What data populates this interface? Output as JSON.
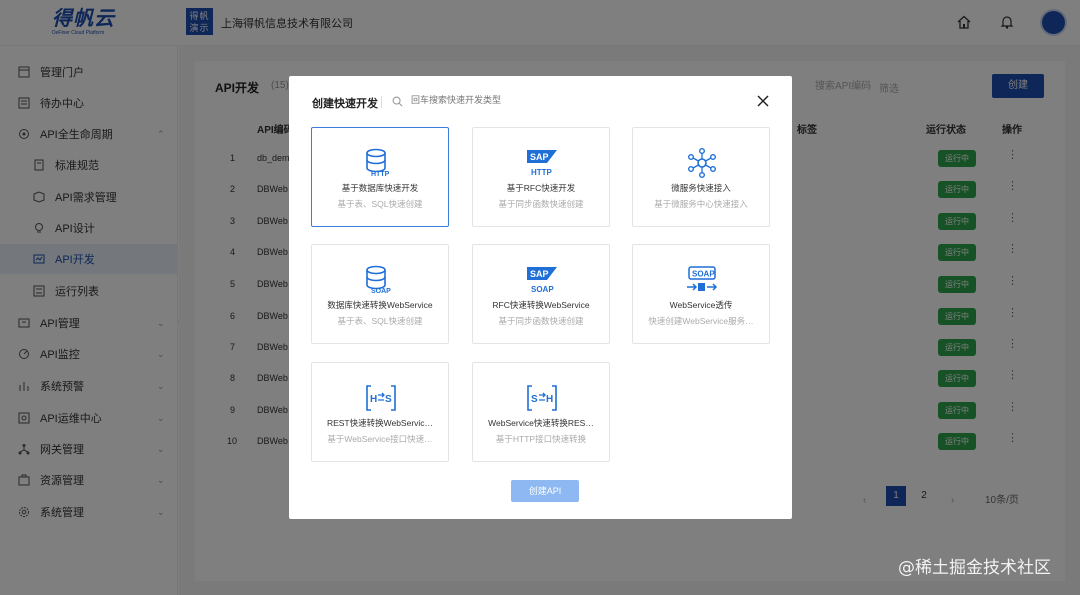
{
  "header": {
    "logo_text": "得帆云",
    "logo_sub": "DeFiner Cloud Platform",
    "company_badge": "得帆 演示",
    "company_name": "上海得帆信息技术有限公司",
    "icons": [
      "home-icon",
      "bell-icon"
    ],
    "avatar": "user-avatar"
  },
  "sidebar": {
    "items": [
      {
        "label": "管理门户",
        "icon": "portal-icon",
        "level": 0
      },
      {
        "label": "待办中心",
        "icon": "todo-icon",
        "level": 0
      },
      {
        "label": "API全生命周期",
        "icon": "lifecycle-icon",
        "level": 0,
        "expanded": true
      },
      {
        "label": "标准规范",
        "icon": "standard-icon",
        "level": 1
      },
      {
        "label": "API需求管理",
        "icon": "requirement-icon",
        "level": 1
      },
      {
        "label": "API设计",
        "icon": "design-icon",
        "level": 1
      },
      {
        "label": "API开发",
        "icon": "develop-icon",
        "level": 1,
        "active": true
      },
      {
        "label": "运行列表",
        "icon": "run-list-icon",
        "level": 1
      },
      {
        "label": "API管理",
        "icon": "api-manage-icon",
        "level": 0
      },
      {
        "label": "API监控",
        "icon": "monitor-icon",
        "level": 0
      },
      {
        "label": "系统预警",
        "icon": "alert-icon",
        "level": 0
      },
      {
        "label": "API运维中心",
        "icon": "ops-icon",
        "level": 0
      },
      {
        "label": "网关管理",
        "icon": "gateway-icon",
        "level": 0
      },
      {
        "label": "资源管理",
        "icon": "resource-icon",
        "level": 0
      },
      {
        "label": "系统管理",
        "icon": "settings-icon",
        "level": 0
      }
    ]
  },
  "main": {
    "title": "API开发",
    "count": "(15)",
    "search_placeholder": "搜索API编码",
    "filter_label": "筛选",
    "create_label": "创建",
    "columns": [
      "API编码",
      "标签",
      "运行状态",
      "操作"
    ],
    "rows": [
      {
        "num": "1",
        "code": "db_dem",
        "status": "运行中"
      },
      {
        "num": "2",
        "code": "DBWeb",
        "status": "运行中"
      },
      {
        "num": "3",
        "code": "DBWeb",
        "status": "运行中"
      },
      {
        "num": "4",
        "code": "DBWeb",
        "status": "运行中"
      },
      {
        "num": "5",
        "code": "DBWeb",
        "status": "运行中"
      },
      {
        "num": "6",
        "code": "DBWeb",
        "status": "运行中"
      },
      {
        "num": "7",
        "code": "DBWeb",
        "status": "运行中"
      },
      {
        "num": "8",
        "code": "DBWeb",
        "status": "运行中"
      },
      {
        "num": "9",
        "code": "DBWeb",
        "status": "运行中"
      },
      {
        "num": "10",
        "code": "DBWeb",
        "status": "运行中"
      }
    ],
    "pagination": {
      "pages": [
        "1",
        "2"
      ],
      "current": "1",
      "page_size": "10条/页"
    }
  },
  "modal": {
    "title": "创建快速开发",
    "search_placeholder": "回车搜索快速开发类型",
    "submit_label": "创建API",
    "tiles": [
      {
        "title": "基于数据库快速开发",
        "subtitle": "基于表、SQL快速创建",
        "icon": "database-http-icon",
        "selected": true
      },
      {
        "title": "基于RFC快速开发",
        "subtitle": "基于同步函数快速创建",
        "icon": "sap-http-icon"
      },
      {
        "title": "微服务快速接入",
        "subtitle": "基于微服务中心快速接入",
        "icon": "microservice-icon"
      },
      {
        "title": "数据库快速转换WebService",
        "subtitle": "基于表、SQL快速创建",
        "icon": "database-soap-icon"
      },
      {
        "title": "RFC快速转换WebService",
        "subtitle": "基于同步函数快速创建",
        "icon": "sap-soap-icon"
      },
      {
        "title": "WebService透传",
        "subtitle": "快速创建WebService服务…",
        "icon": "soap-passthrough-icon"
      },
      {
        "title": "REST快速转换WebServic…",
        "subtitle": "基于WebService接口快速…",
        "icon": "rest-to-soap-icon"
      },
      {
        "title": "WebService快速转换RES…",
        "subtitle": "基于HTTP接口快速转换",
        "icon": "soap-to-rest-icon"
      }
    ]
  },
  "watermark": "@稀土掘金技术社区",
  "colors": {
    "brand": "#1d4fb0",
    "selected_border": "#3b7ddd",
    "status_green": "#2ea44f",
    "submit_disabled": "#8db8f2"
  }
}
